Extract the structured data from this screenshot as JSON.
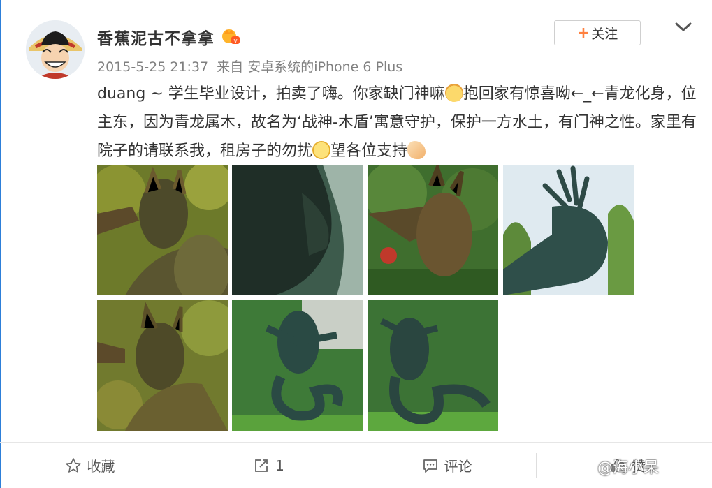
{
  "post": {
    "user_name": "香蕉泥古不拿拿",
    "timestamp": "2015-5-25 21:37",
    "source": "来自 安卓系统的iPhone 6 Plus",
    "follow_label": "关注",
    "text_parts": [
      "duang ~ 学生毕业设计，拍卖了嗨。你家缺门神嘛",
      "抱回家有惊喜呦←_←青龙化身，位主东，因为青龙属木，故名为‘战神-木盾’寓意守护，保护一方水土，有门神之性。家里有院子的请联系我，租房子的勿扰",
      "望各位支持"
    ],
    "emoticons": [
      "cat-emoji-icon",
      "shy-emoji-icon",
      "praying-hands-icon"
    ]
  },
  "images": [
    {
      "name": "photo-statue-1"
    },
    {
      "name": "photo-statue-2"
    },
    {
      "name": "photo-statue-3"
    },
    {
      "name": "photo-statue-4"
    },
    {
      "name": "photo-statue-5"
    },
    {
      "name": "photo-statue-6"
    },
    {
      "name": "photo-statue-7"
    }
  ],
  "actions": {
    "favorite_label": "收藏",
    "repost_count": "1",
    "comment_label": "评论",
    "like_label": "赞"
  },
  "watermark": "@海小呆",
  "colors": {
    "accent_orange": "#ff8140",
    "meta_gray": "#808080",
    "left_edge_blue": "#2d7fd9"
  }
}
